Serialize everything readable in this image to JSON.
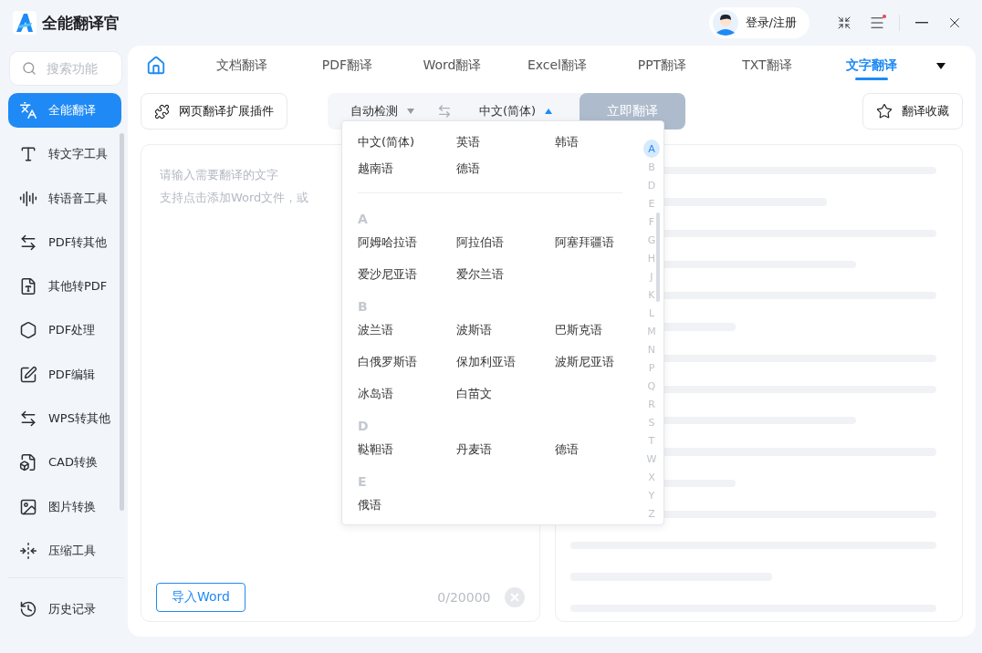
{
  "app": {
    "title": "全能翻译官"
  },
  "header": {
    "login": "登录/注册",
    "has_notification": true
  },
  "sidebar": {
    "search": {
      "placeholder": "搜索功能"
    },
    "items": [
      {
        "label": "全能翻译",
        "selected": true
      },
      {
        "label": "转文字工具",
        "selected": false
      },
      {
        "label": "转语音工具",
        "selected": false
      },
      {
        "label": "PDF转其他",
        "selected": false
      },
      {
        "label": "其他转PDF",
        "selected": false
      },
      {
        "label": "PDF处理",
        "selected": false
      },
      {
        "label": "PDF编辑",
        "selected": false
      },
      {
        "label": "WPS转其他",
        "selected": false
      },
      {
        "label": "CAD转换",
        "selected": false
      },
      {
        "label": "图片转换",
        "selected": false
      },
      {
        "label": "压缩工具",
        "selected": false
      }
    ],
    "footer": {
      "label": "历史记录"
    }
  },
  "tabs": [
    {
      "kind": "home",
      "selected": false
    },
    {
      "kind": "text",
      "label": "文档翻译",
      "selected": false
    },
    {
      "kind": "text",
      "label": "PDF翻译",
      "selected": false
    },
    {
      "kind": "text",
      "label": "Word翻译",
      "selected": false
    },
    {
      "kind": "text",
      "label": "Excel翻译",
      "selected": false
    },
    {
      "kind": "text",
      "label": "PPT翻译",
      "selected": false
    },
    {
      "kind": "text",
      "label": "TXT翻译",
      "selected": false
    },
    {
      "kind": "text",
      "label": "文字翻译",
      "selected": true
    }
  ],
  "toolbar": {
    "extension": "网页翻译扩展插件",
    "source": "自动检测",
    "target": "中文(简体)",
    "target_open": true,
    "translate": {
      "label": "立即翻译",
      "disabled": true
    },
    "favorites": "翻译收藏"
  },
  "input": {
    "placeholder_lines": [
      "请输入需要翻译的文字",
      "支持点击添加Word文件，或"
    ],
    "import": "导入Word",
    "count": "0/20000"
  },
  "dropdown": {
    "common": [
      "中文(简体)",
      "英语",
      "韩语",
      "越南语",
      "德语"
    ],
    "groups": [
      {
        "letter": "A",
        "languages": [
          "阿姆哈拉语",
          "阿拉伯语",
          "阿塞拜疆语",
          "爱沙尼亚语",
          "爱尔兰语"
        ]
      },
      {
        "letter": "B",
        "languages": [
          "波兰语",
          "波斯语",
          "巴斯克语",
          "白俄罗斯语",
          "保加利亚语",
          "波斯尼亚语",
          "冰岛语",
          "白苗文"
        ]
      },
      {
        "letter": "D",
        "languages": [
          "鞑靼语",
          "丹麦语",
          "德语"
        ]
      },
      {
        "letter": "E",
        "languages": [
          "俄语"
        ]
      }
    ],
    "index": [
      {
        "letter": "A",
        "selected": true
      },
      {
        "letter": "B",
        "selected": false
      },
      {
        "letter": "D",
        "selected": false
      },
      {
        "letter": "E",
        "selected": false
      },
      {
        "letter": "F",
        "selected": false
      },
      {
        "letter": "G",
        "selected": false
      },
      {
        "letter": "H",
        "selected": false
      },
      {
        "letter": "J",
        "selected": false
      },
      {
        "letter": "K",
        "selected": false
      },
      {
        "letter": "L",
        "selected": false
      },
      {
        "letter": "M",
        "selected": false
      },
      {
        "letter": "N",
        "selected": false
      },
      {
        "letter": "P",
        "selected": false
      },
      {
        "letter": "Q",
        "selected": false
      },
      {
        "letter": "R",
        "selected": false
      },
      {
        "letter": "S",
        "selected": false
      },
      {
        "letter": "T",
        "selected": false
      },
      {
        "letter": "W",
        "selected": false
      },
      {
        "letter": "X",
        "selected": false
      },
      {
        "letter": "Y",
        "selected": false
      },
      {
        "letter": "Z",
        "selected": false
      }
    ]
  }
}
